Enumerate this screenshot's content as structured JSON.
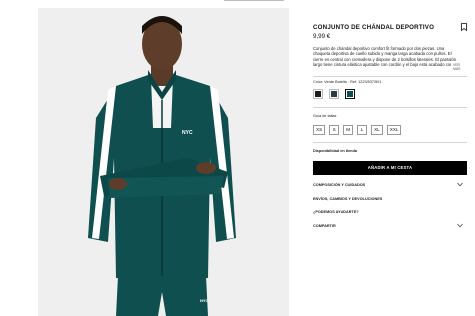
{
  "product": {
    "title": "CONJUNTO DE CHÁNDAL DEPORTIVO",
    "price": "9,99 €",
    "description": "Conjunto de chándal deportivo comfort fit formado por dos piezas. Una chaqueta deportiva de cuello subido y manga larga acabada con puños. El cierre es central con cremallera y dispone de 2 bolsillos laterales. El pantalón largo tiene cintura elástica ajustable con cordón y el bajo está acabado con puños.",
    "see_more": "VER MÁS",
    "color_label": "Color: Verde Botella · Ref. 1223/537/501",
    "swatches": [
      "#1c1c1c",
      "#2a3a48",
      "#0f4f4f"
    ],
    "selected_swatch": 2,
    "size_guide": "Guía de tallas",
    "sizes": [
      "XS",
      "S",
      "M",
      "L",
      "XL",
      "XXL"
    ],
    "store_availability": "Disponibilidad en tienda",
    "add_to_cart": "AÑADIR A MI CESTA",
    "accordion": {
      "composition": "COMPOSICIÓN Y CUIDADOS",
      "shipping": "ENVÍOS, CAMBIOS Y DEVOLUCIONES",
      "help": "¿PODEMOS AYUDARTE?",
      "share": "COMPARTIR"
    }
  },
  "photo": {
    "chest_logo": "NYC",
    "pants_logo": "NYC",
    "garment_color": "#0f4f4f",
    "stripe_color": "#ffffff"
  },
  "icons": {
    "bookmark": "bookmark-icon",
    "chevron": "chevron-down-icon"
  }
}
